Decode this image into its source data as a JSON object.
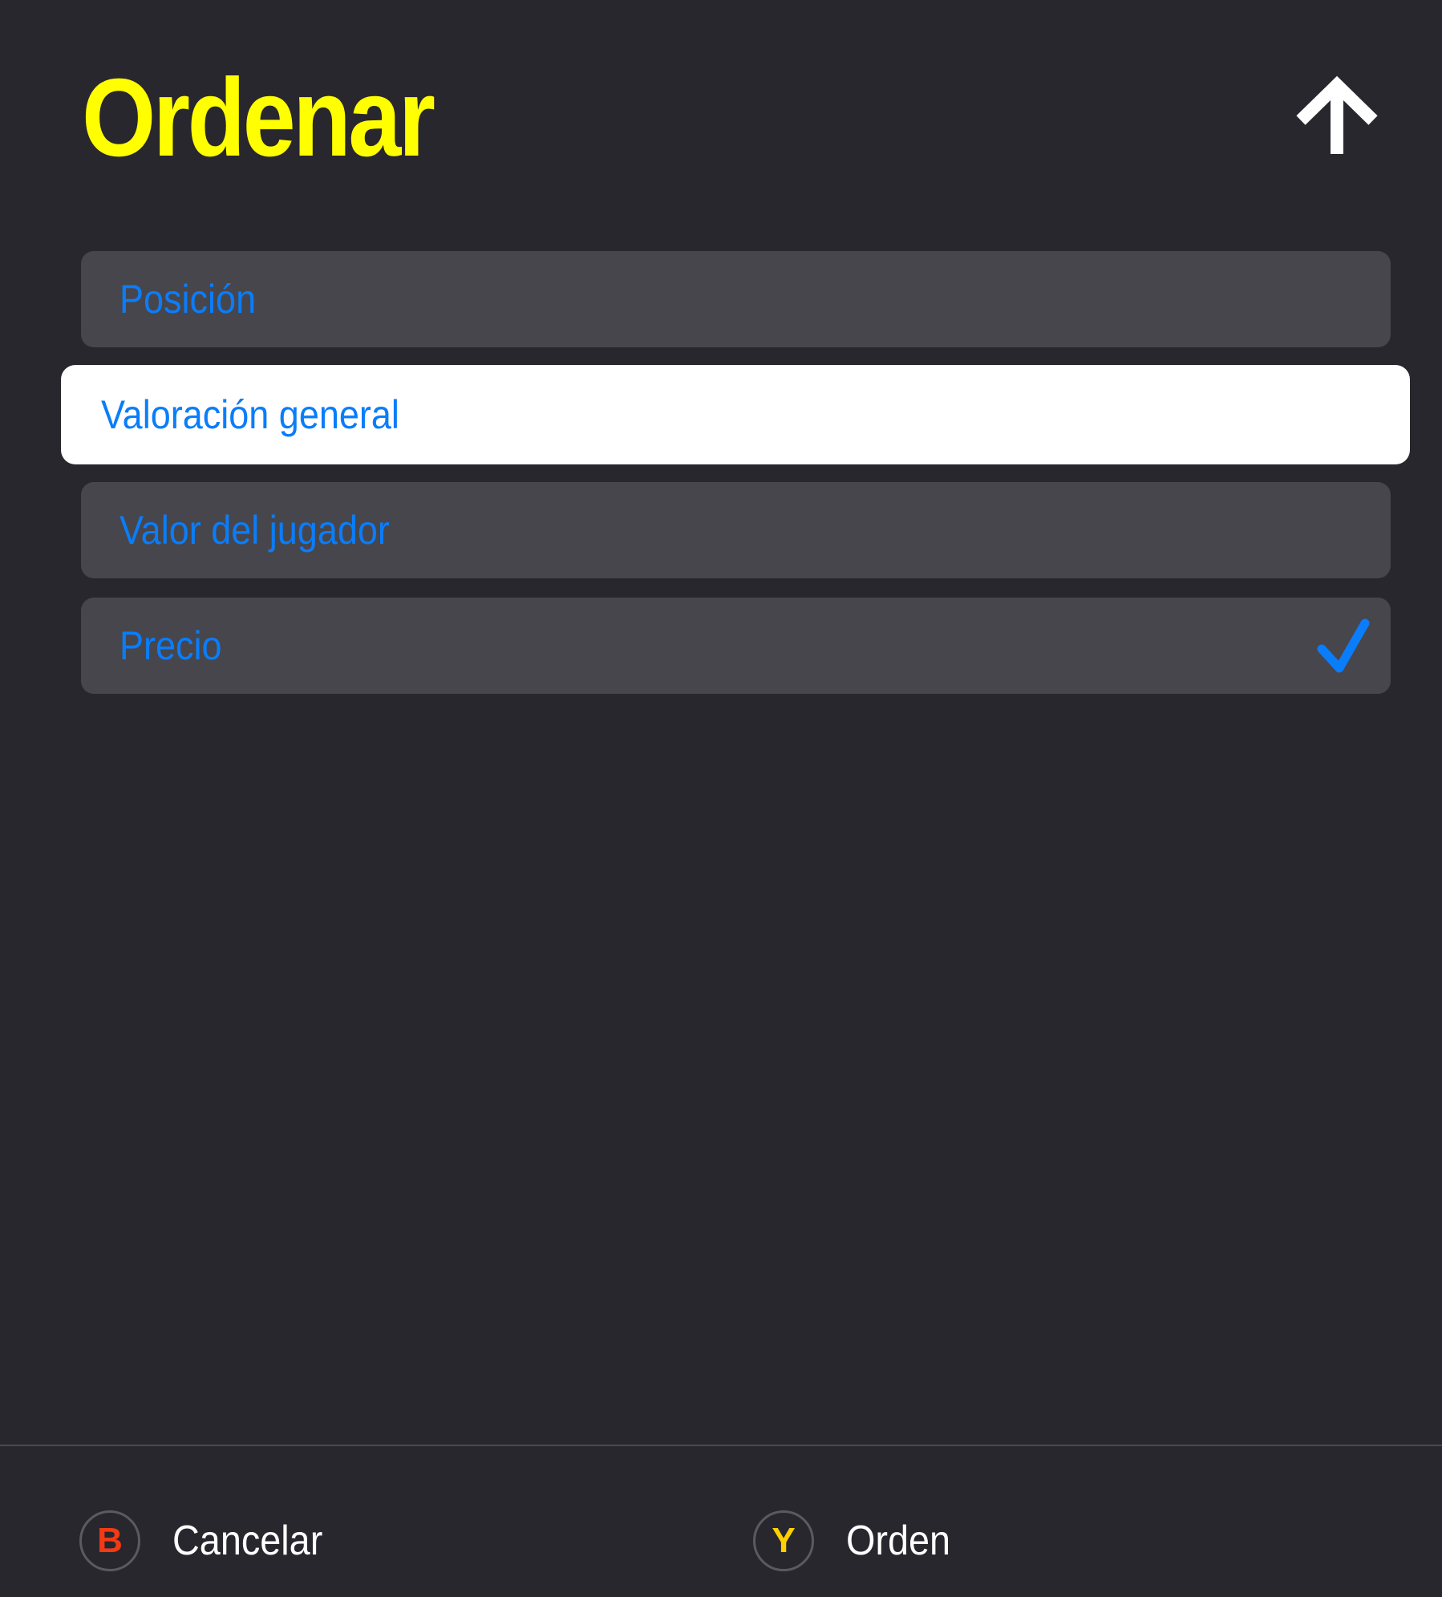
{
  "dialog": {
    "title": "Ordenar",
    "sort_direction_icon": "arrow-up-icon"
  },
  "options": [
    {
      "label": "Posición",
      "focused": false,
      "selected": false
    },
    {
      "label": "Valoración general",
      "focused": true,
      "selected": false
    },
    {
      "label": "Valor del jugador",
      "focused": false,
      "selected": false
    },
    {
      "label": "Precio",
      "focused": false,
      "selected": true
    }
  ],
  "footer": {
    "cancel": {
      "button": "B",
      "label": "Cancelar"
    },
    "order": {
      "button": "Y",
      "label": "Orden"
    }
  },
  "colors": {
    "background": "#28272d",
    "title": "#ffff00",
    "option_bg": "#47464c",
    "option_focused_bg": "#ffffff",
    "option_text": "#0a7dfa",
    "button_b": "#f23a14",
    "button_y": "#ffd000"
  }
}
